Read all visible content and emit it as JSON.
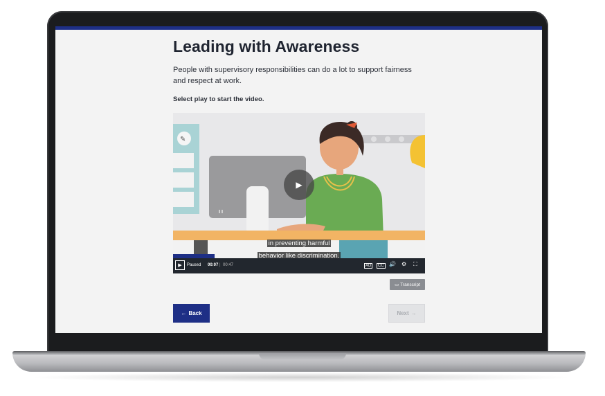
{
  "page": {
    "title": "Leading with Awareness",
    "intro": "People with supervisory responsibilities can do a lot to support fairness and respect at work.",
    "instruction": "Select play to start the video."
  },
  "video": {
    "caption_line1": "in preventing harmful",
    "caption_line2": "behavior like discrimination.",
    "state": "Paused",
    "current_time": "00:07",
    "separator": "|",
    "duration": "00:47",
    "progress": 0.15
  },
  "buttons": {
    "transcript": "Transcript",
    "back": "Back",
    "next": "Next"
  },
  "icons": {
    "back_arrow": "←",
    "next_arrow": "→",
    "play": "▶",
    "transcript": "▭",
    "audio_description": "AD",
    "cc": "CC",
    "volume": "🔊",
    "settings": "⚙",
    "fullscreen": "⛶"
  },
  "colors": {
    "accent": "#1e2f86",
    "screen_bg": "#f3f3f3",
    "controls_bg": "#22272e"
  }
}
